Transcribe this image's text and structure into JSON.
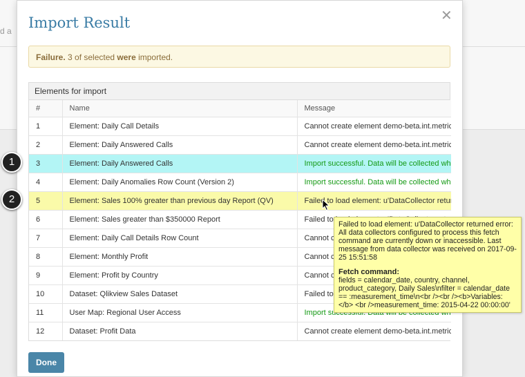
{
  "background": {
    "partial_text": "d a"
  },
  "modal": {
    "title": "Import Result",
    "close_glyph": "✕",
    "alert": {
      "strong": "Failure.",
      "mid": " 3 of selected ",
      "strong2": "were",
      "end": " imported."
    },
    "panel_title": "Elements for import",
    "columns": [
      "#",
      "Name",
      "Message"
    ],
    "rows": [
      {
        "num": "1",
        "name": "Element: Daily Call Details",
        "message": "Cannot create element demo-beta.int.metricinsights.com",
        "status": "std",
        "highlight": "none"
      },
      {
        "num": "2",
        "name": "Element: Daily Answered Calls",
        "message": "Cannot create element demo-beta.int.metricinsights.com",
        "status": "std",
        "highlight": "none"
      },
      {
        "num": "3",
        "name": "Element: Daily Answered Calls",
        "message": "Import successful. Data will be collected when",
        "status": "ok",
        "highlight": "cyan"
      },
      {
        "num": "4",
        "name": "Element: Daily Anomalies Row Count (Version 2)",
        "message": "Import successful. Data will be collected when",
        "status": "ok",
        "highlight": "none"
      },
      {
        "num": "5",
        "name": "Element: Sales 100% greater than previous day Report (QV)",
        "message": "Failed to load element: u'DataCollector returned",
        "status": "std",
        "highlight": "yellow"
      },
      {
        "num": "6",
        "name": "Element: Sales greater than $350000 Report",
        "message": "Failed to load element: u'DataCollector returned",
        "status": "std",
        "highlight": "none"
      },
      {
        "num": "7",
        "name": "Element: Daily Call Details Row Count",
        "message": "Cannot create element",
        "status": "std",
        "highlight": "none"
      },
      {
        "num": "8",
        "name": "Element: Monthly Profit",
        "message": "Cannot create element",
        "status": "std",
        "highlight": "none"
      },
      {
        "num": "9",
        "name": "Element: Profit by Country",
        "message": "Cannot create element",
        "status": "std",
        "highlight": "none"
      },
      {
        "num": "10",
        "name": "Dataset: Qlikview Sales Dataset",
        "message": "Failed to load",
        "status": "std",
        "highlight": "none"
      },
      {
        "num": "11",
        "name": "User Map: Regional User Access",
        "message": "Import successful. Data will be collected when",
        "status": "ok",
        "highlight": "none"
      },
      {
        "num": "12",
        "name": "Dataset: Profit Data",
        "message": "Cannot create element demo-beta.int.metricinsights.com",
        "status": "std",
        "highlight": "none"
      }
    ],
    "done_label": "Done"
  },
  "badges": [
    "1",
    "2"
  ],
  "tooltip": {
    "main": "Failed to load element: u'DataCollector returned error: All data collectors configured to process this fetch command are currently down or inaccessible. Last message from data collector was received on 2017-09-25 15:51:58",
    "fetch_heading": "Fetch command:",
    "fetch_body": "fields = calendar_date, country, channel, product_category, Daily Sales\\nfilter = calendar_date == :measurement_time\\n<br /><br /><b>Variables:</b> <br />measurement_time: 2015-04-22 00:00:00'"
  },
  "colors": {
    "title": "#3a7ca5",
    "done_button": "#4a86a8",
    "success_text": "#139913",
    "row_cyan": "#b3f5f5",
    "row_yellow": "#fafaa9",
    "tooltip_bg": "#ffffa8"
  }
}
